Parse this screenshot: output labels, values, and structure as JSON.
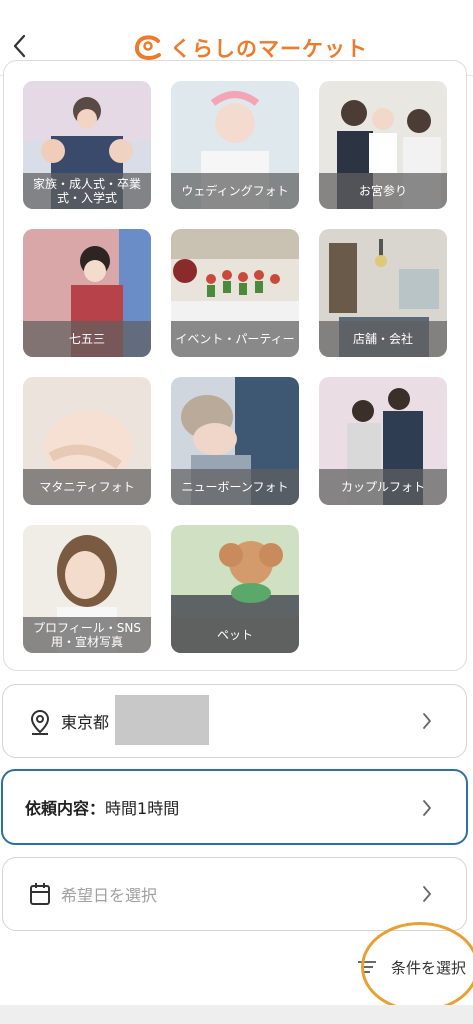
{
  "header": {
    "logo_text": "くらしのマーケット",
    "brand_color": "#ee7a2b"
  },
  "categories": [
    {
      "label": "家族・成人式・卒業式・入学式"
    },
    {
      "label": "ウェディングフォト"
    },
    {
      "label": "お宮参り"
    },
    {
      "label": "七五三"
    },
    {
      "label": "イベント・パーティー"
    },
    {
      "label": "店舗・会社"
    },
    {
      "label": "マタニティフォト"
    },
    {
      "label": "ニューボーンフォト"
    },
    {
      "label": "カップルフォト"
    },
    {
      "label": "プロフィール・SNS用・宣材写真"
    },
    {
      "label": "ペット"
    }
  ],
  "filters": {
    "location": {
      "value": "東京都",
      "icon": "location-pin-icon"
    },
    "request": {
      "label": "依頼内容：",
      "value": "時間1時間"
    },
    "date": {
      "placeholder": "希望日を選択",
      "icon": "calendar-icon"
    }
  },
  "conditions": {
    "label": "条件を選択",
    "icon": "filter-icon",
    "highlight_color": "#e8a033"
  },
  "colors": {
    "active_border": "#2f6fa5"
  }
}
